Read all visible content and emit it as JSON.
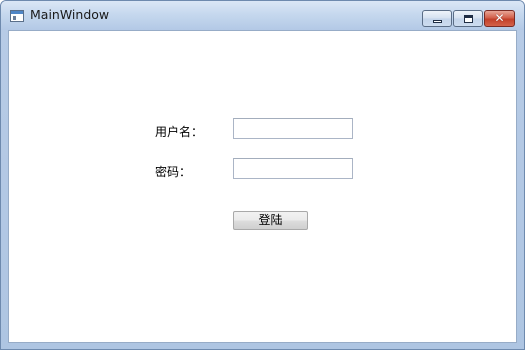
{
  "window": {
    "title": "MainWindow",
    "icon": "window-app-icon",
    "controls": {
      "minimize_icon": "minimize-icon",
      "maximize_icon": "maximize-icon",
      "close_icon": "close-icon",
      "close_glyph": "✕"
    }
  },
  "form": {
    "username_label": "用户名：",
    "username_value": "",
    "password_label": "密码：",
    "password_value": "",
    "login_button": "登陆"
  },
  "colors": {
    "title_bar": "#c6d8ee",
    "close_button": "#c2402a",
    "client_background": "#ffffff"
  }
}
